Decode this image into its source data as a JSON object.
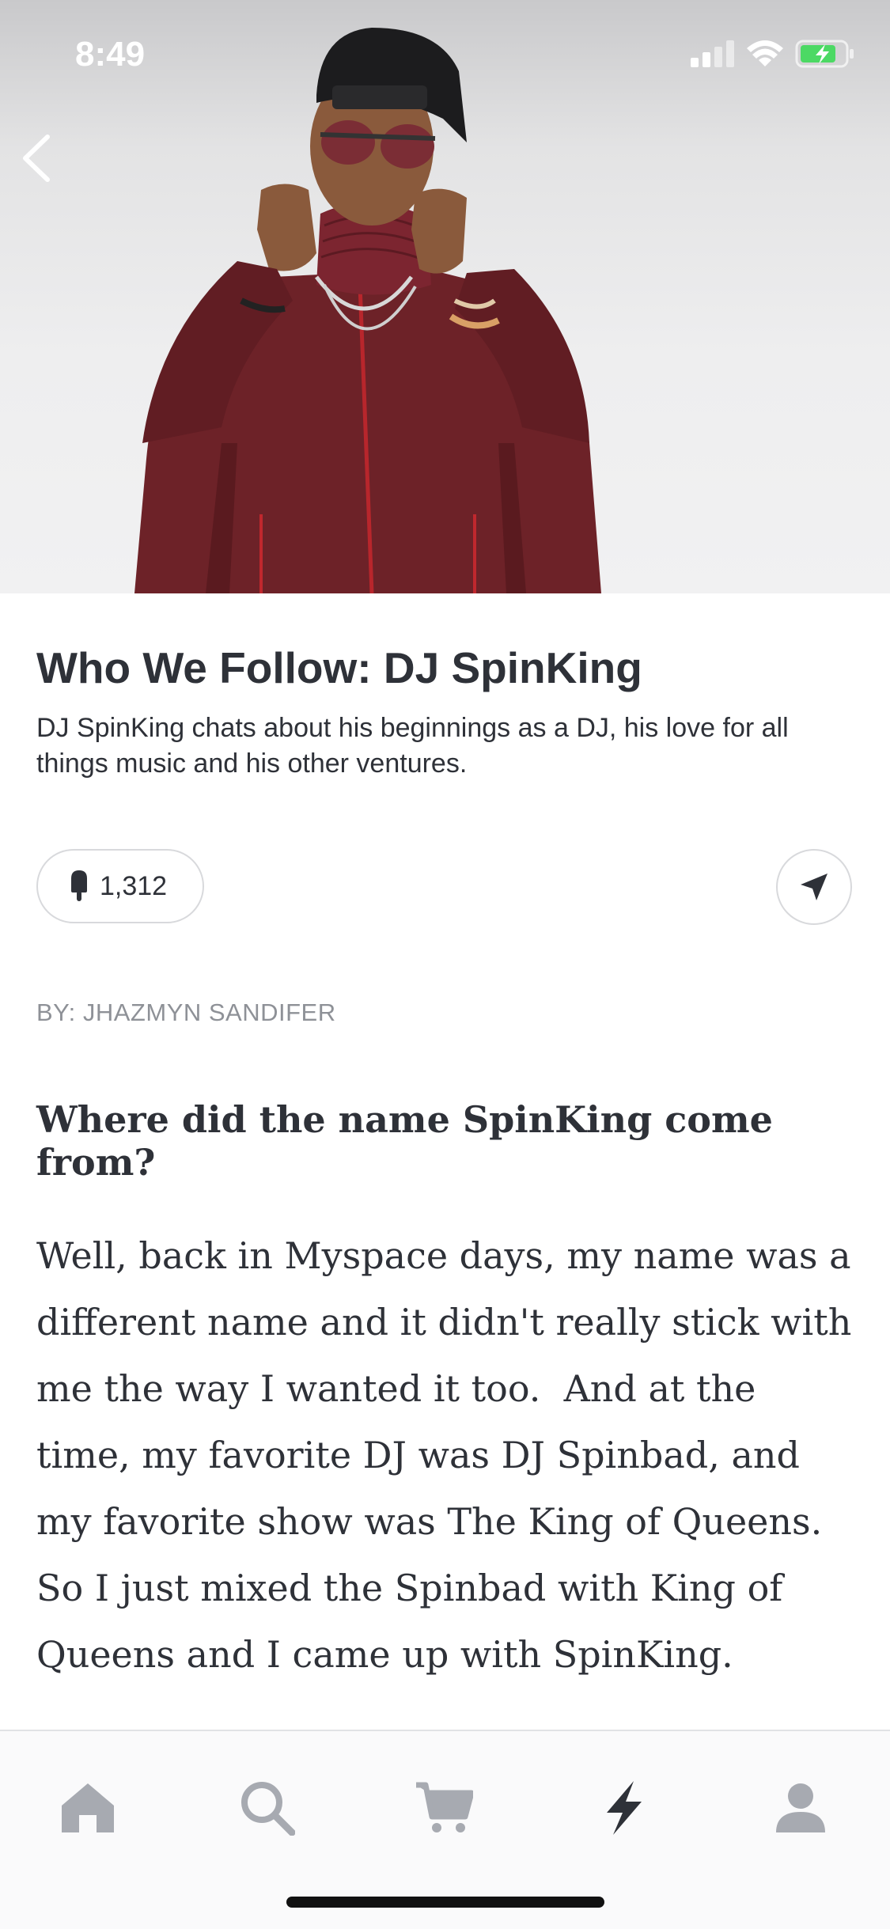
{
  "status_bar": {
    "time": "8:49"
  },
  "article": {
    "title": "Who We Follow: DJ SpinKing",
    "subtitle": "DJ SpinKing chats about his beginnings as a DJ, his love for all things music and his other ventures.",
    "likes": "1,312",
    "byline": "BY: JHAZMYN SANDIFER",
    "question": "Where did the name SpinKing come from?",
    "answer": "Well, back in Myspace days, my name was a different name and it didn't really stick with me the way I wanted it too.  And at the time, my favorite DJ was DJ Spinbad, and my favorite show was The King of Queens.  So I just mixed the Spinbad with King of Queens and I came up with SpinKing."
  },
  "tabbar": {
    "items": [
      {
        "icon": "home-icon"
      },
      {
        "icon": "search-icon"
      },
      {
        "icon": "cart-icon"
      },
      {
        "icon": "lightning-icon",
        "active": true
      },
      {
        "icon": "profile-icon"
      }
    ]
  },
  "colors": {
    "accent": "#2e3138",
    "inactive_icon": "#a7aab1",
    "jacket": "#6d2228"
  }
}
